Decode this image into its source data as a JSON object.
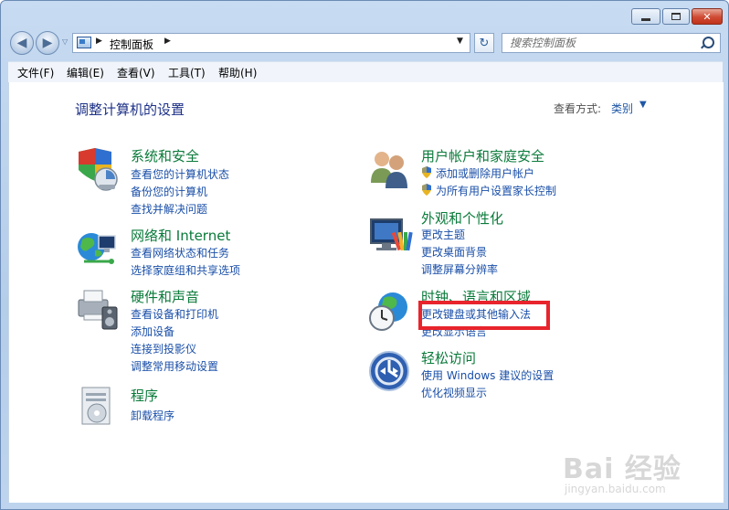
{
  "window": {
    "close_glyph": "✕"
  },
  "nav": {
    "back_glyph": "◀",
    "forward_glyph": "▶",
    "dropdown_glyph": "▽",
    "address_separator": "▶",
    "address_path": "控制面板",
    "address_path_separator": "▶",
    "address_dropdown": "▼",
    "refresh_glyph": "↻",
    "search_placeholder": "搜索控制面板"
  },
  "menu": [
    "文件(F)",
    "编辑(E)",
    "查看(V)",
    "工具(T)",
    "帮助(H)"
  ],
  "content": {
    "title": "调整计算机的设置",
    "view_label": "查看方式:",
    "view_value": "类别",
    "view_arrow": "▼"
  },
  "categories": {
    "system_security": {
      "title": "系统和安全",
      "links": [
        "查看您的计算机状态",
        "备份您的计算机",
        "查找并解决问题"
      ]
    },
    "network": {
      "title": "网络和 Internet",
      "links": [
        "查看网络状态和任务",
        "选择家庭组和共享选项"
      ]
    },
    "hardware": {
      "title": "硬件和声音",
      "links": [
        "查看设备和打印机",
        "添加设备",
        "连接到投影仪",
        "调整常用移动设置"
      ]
    },
    "programs": {
      "title": "程序",
      "links": [
        "卸载程序"
      ]
    },
    "users": {
      "title": "用户帐户和家庭安全",
      "links": [
        "添加或删除用户帐户",
        "为所有用户设置家长控制"
      ]
    },
    "appearance": {
      "title": "外观和个性化",
      "links": [
        "更改主题",
        "更改桌面背景",
        "调整屏幕分辨率"
      ]
    },
    "clock": {
      "title": "时钟、语言和区域",
      "links": [
        "更改键盘或其他输入法",
        "更改显示语言"
      ]
    },
    "ease": {
      "title": "轻松访问",
      "links": [
        "使用 Windows 建议的设置",
        "优化视频显示"
      ]
    }
  },
  "watermark": {
    "main": "Bai  经验",
    "sub": "jingyan.baidu.com"
  },
  "colors": {
    "category_title": "#0a7a3a",
    "link": "#1a4fa8",
    "page_title": "#1e3287",
    "highlight_border": "#e8242c"
  }
}
